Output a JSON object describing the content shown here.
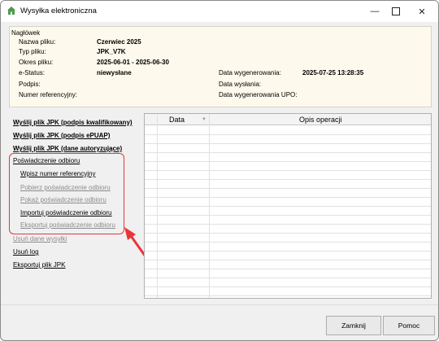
{
  "window": {
    "title": "Wysyłka elektroniczna"
  },
  "header_group": {
    "label": "Nagłówek",
    "fields": {
      "nazwa_pliku": {
        "label": "Nazwa pliku:",
        "value": "Czerwiec 2025"
      },
      "typ_pliku": {
        "label": "Typ pliku:",
        "value": "JPK_V7K"
      },
      "okres_pliku": {
        "label": "Okres pliku:",
        "value": "2025-06-01 - 2025-06-30"
      },
      "e_status": {
        "label": "e-Status:",
        "value": "niewysłane"
      },
      "podpis": {
        "label": "Podpis:",
        "value": ""
      },
      "numer_referencyjny": {
        "label": "Numer referencyjny:",
        "value": ""
      },
      "data_wygenerowania": {
        "label": "Data wygenerowania:",
        "value": "2025-07-25 13:28:35"
      },
      "data_wyslania": {
        "label": "Data wysłania:",
        "value": ""
      },
      "data_wygenerowania_upo": {
        "label": "Data wygenerowania UPO:",
        "value": ""
      }
    }
  },
  "actions": {
    "send_qualified": "Wyślij plik JPK (podpis kwalifikowany)",
    "send_epuap": "Wyślij plik JPK (podpis ePUAP)",
    "send_auth": "Wyślij plik JPK (dane autoryzujące)",
    "confirmation_header": "Poświadczenie odbioru",
    "enter_ref": "Wpisz numer referencyjny",
    "get_confirmation": "Pobierz poświadczenie odbioru",
    "show_confirmation": "Pokaż poświadczenie odbioru",
    "import_confirmation": "Importuj poświadczenie odbioru",
    "export_confirmation": "Eksportuj poświadczenie odbioru",
    "delete_send_data": "Usuń dane wysyłki",
    "delete_log": "Usuń log",
    "export_jpk": "Eksportuj plik JPK"
  },
  "log_table": {
    "columns": [
      "Data",
      "Opis operacji"
    ],
    "rows": []
  },
  "buttons": {
    "close": "Zamknij",
    "help": "Pomoc"
  },
  "colors": {
    "highlight": "#e8353b",
    "header_bg": "#fdf9ec"
  }
}
